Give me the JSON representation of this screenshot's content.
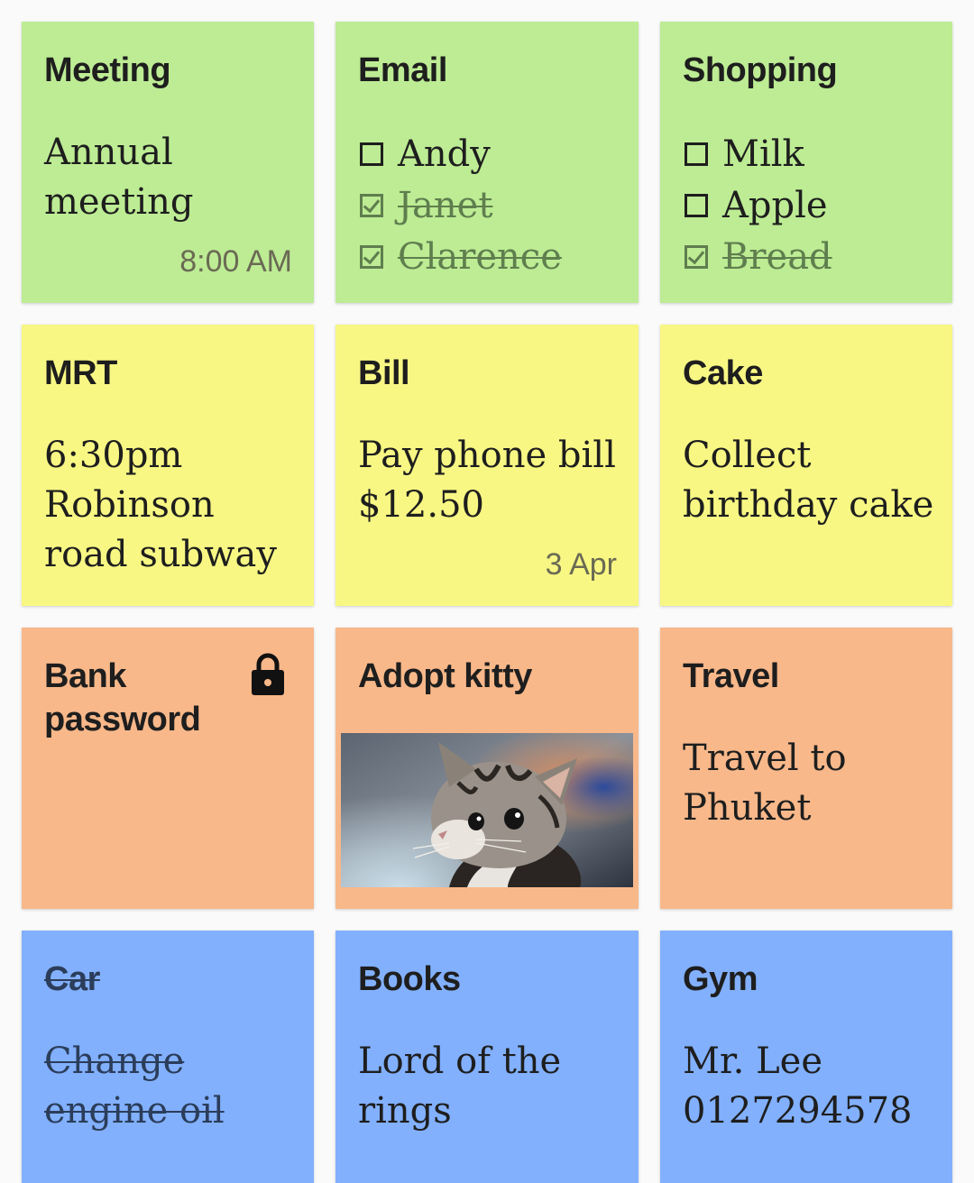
{
  "notes": [
    {
      "title": "Meeting",
      "text": "Annual meeting",
      "meta": "8:00 AM"
    },
    {
      "title": "Email",
      "items": [
        {
          "label": "Andy",
          "checked": false
        },
        {
          "label": "Janet",
          "checked": true
        },
        {
          "label": "Clarence",
          "checked": true
        }
      ]
    },
    {
      "title": "Shopping",
      "items": [
        {
          "label": "Milk",
          "checked": false
        },
        {
          "label": "Apple",
          "checked": false
        },
        {
          "label": "Bread",
          "checked": true
        }
      ]
    },
    {
      "title": "MRT",
      "text": "6:30pm Robinson road subway"
    },
    {
      "title": "Bill",
      "text": "Pay phone bill $12.50",
      "meta": "3 Apr"
    },
    {
      "title": "Cake",
      "text": "Collect birthday cake"
    },
    {
      "title": "Bank password",
      "icon": "lock-icon"
    },
    {
      "title": "Adopt kitty",
      "image": "kitten-photo"
    },
    {
      "title": "Travel",
      "text": "Travel to Phuket"
    },
    {
      "title": "Car",
      "text": "Change engine oil",
      "struck": true
    },
    {
      "title": "Books",
      "text": "Lord of the rings"
    },
    {
      "title": "Gym",
      "text": "Mr. Lee 0127294578"
    }
  ],
  "colors": {
    "green": "#bdec94",
    "yellow": "#f8f784",
    "orange": "#f8b88a",
    "blue": "#82b0fd",
    "background": "#fafafa"
  }
}
